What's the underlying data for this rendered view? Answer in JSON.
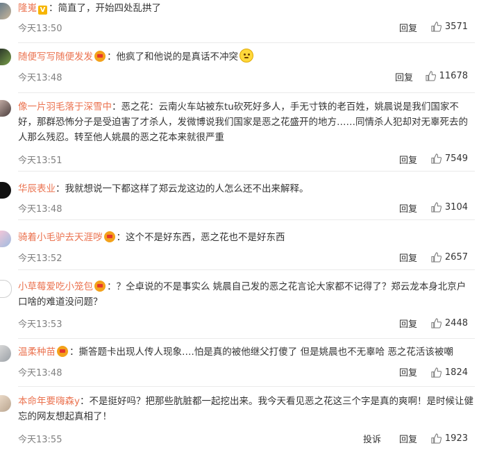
{
  "comments": [
    {
      "user": "隆嵬",
      "text": "：简直了，开始四处乱拱了",
      "time": "今天13:50",
      "reply": "回复",
      "likes": "3571"
    },
    {
      "user": "随便写写随便发发",
      "text": "：他疯了和他说的是真话不冲突",
      "time": "今天13:48",
      "reply": "回复",
      "likes": "11678"
    },
    {
      "user": "像一片羽毛落于深雪中",
      "text": "：恶之花：云南火车站被东tu砍死好多人，手无寸铁的老百姓，姚晨说是我们国家不好，那群恐怖分子是受迫害了才杀人，发微博说我们国家是恶之花盛开的地方……同情杀人犯却对无辜死去的人那么残忍。转至他人姚晨的恶之花本来就很严重",
      "time": "今天13:51",
      "reply": "回复",
      "likes": "7549"
    },
    {
      "user": "华辰表业",
      "text": "：我就想说一下都这样了郑云龙这边的人怎么还不出来解释。",
      "time": "今天13:48",
      "reply": "回复",
      "likes": "3104"
    },
    {
      "user": "骑着小毛驴去天涯哕",
      "text": "：这个不是好东西，恶之花也不是好东西",
      "time": "今天13:52",
      "reply": "回复",
      "likes": "2657"
    },
    {
      "user": "小草莓爱吃小笼包",
      "text": "：？仝卓说的不是事实么 姚晨自己发的恶之花言论大家都不记得了？郑云龙本身北京户口啥的难道没问题？",
      "time": "今天13:53",
      "reply": "回复",
      "likes": "2448"
    },
    {
      "user": "温柔种苗",
      "text": "：撕答题卡出现人传人现象….怕是真的被他继父打傻了 但是姚晨也不无辜哈 恶之花活该被嘲",
      "time": "今天13:48",
      "reply": "回复",
      "likes": "1824"
    },
    {
      "user": "本命年要嗨森y",
      "text": "：不是挺好吗？把那些肮脏都一起挖出来。我今天看见恶之花这三个字是真的爽啊！是时候让健忘的网友想起真相了！",
      "time": "今天13:55",
      "report": "投诉",
      "reply": "回复",
      "likes": "1923"
    }
  ],
  "colors": {
    "username": "#eb7350",
    "time": "#808080",
    "text": "#333333"
  }
}
